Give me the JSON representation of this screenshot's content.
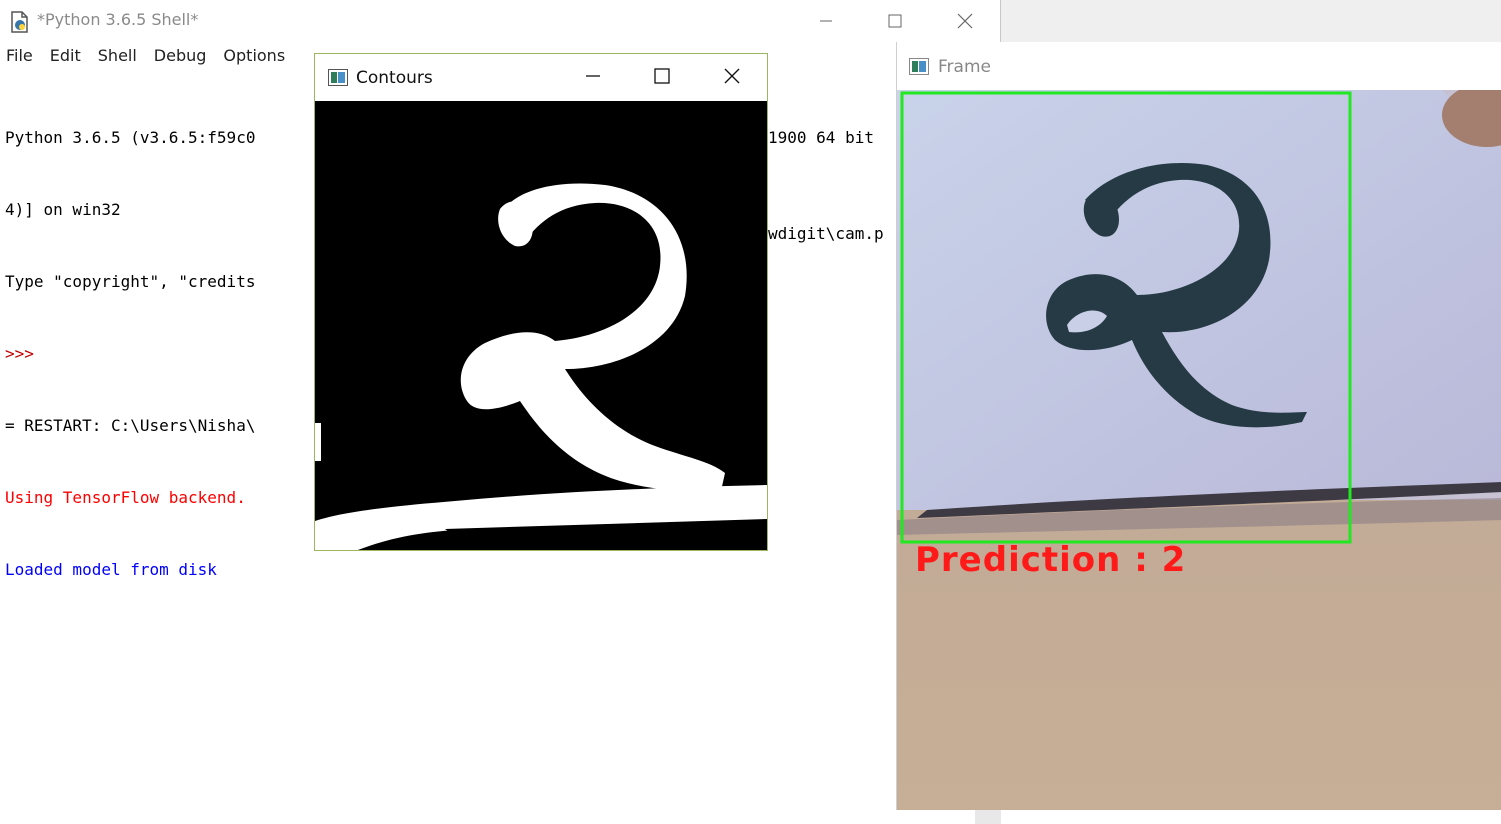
{
  "shell": {
    "title": "*Python 3.6.5 Shell*",
    "menu": [
      "File",
      "Edit",
      "Shell",
      "Debug",
      "Options"
    ],
    "lines": [
      {
        "text": "Python 3.6.5 (v3.6.5:f59c0",
        "color": "#000000"
      },
      {
        "text": "4)] on win32",
        "color": "#000000"
      },
      {
        "text": "Type \"copyright\", \"credits",
        "color": "#000000"
      },
      {
        "text": ">>>",
        "color": "#c00000"
      },
      {
        "text": "= RESTART: C:\\Users\\Nisha\\",
        "color": "#000000"
      },
      {
        "text": "Using TensorFlow backend.",
        "color": "#ff0000"
      },
      {
        "text": "Loaded model from disk",
        "color": "#0000ff"
      }
    ],
    "right_fragments": [
      "1900 64 bit",
      "wdigit\\cam.p"
    ]
  },
  "contours": {
    "title": "Contours"
  },
  "frame": {
    "title": "Frame",
    "prediction": "Prediction : 2"
  },
  "colors": {
    "stdout": "#000000",
    "prompt": "#c00000",
    "stderr": "#ff0000",
    "output_blue": "#0000ff",
    "bbox_green": "#22e822",
    "prediction_red": "#ff1a1a"
  },
  "icons": [
    "python-file-icon",
    "opencv-window-icon",
    "minimize-icon",
    "maximize-icon",
    "close-icon"
  ]
}
